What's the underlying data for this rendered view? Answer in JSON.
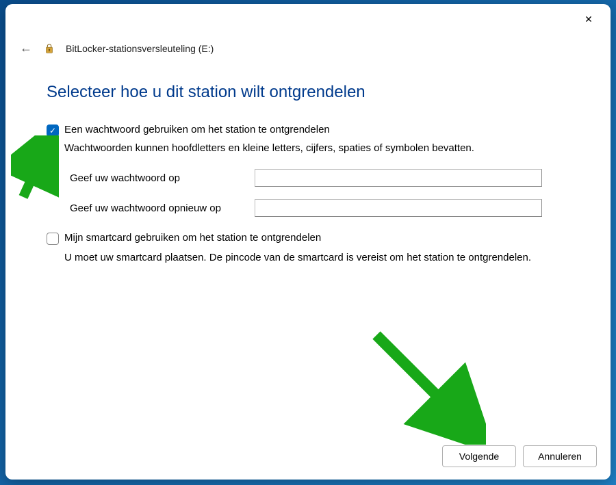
{
  "window": {
    "breadcrumb": "BitLocker-stationsversleuteling (E:)"
  },
  "page": {
    "title": "Selecteer hoe u dit station wilt ontgrendelen"
  },
  "options": {
    "password": {
      "checked": true,
      "label": "Een wachtwoord gebruiken om het station te ontgrendelen",
      "helper": "Wachtwoorden kunnen hoofdletters en kleine letters, cijfers, spaties of symbolen bevatten.",
      "field1_label": "Geef uw wachtwoord op",
      "field1_value": "",
      "field2_label": "Geef uw wachtwoord opnieuw op",
      "field2_value": ""
    },
    "smartcard": {
      "checked": false,
      "label": "Mijn smartcard gebruiken om het station te ontgrendelen",
      "helper": "U moet uw smartcard plaatsen. De pincode van de smartcard is vereist om het station te ontgrendelen."
    }
  },
  "footer": {
    "next": "Volgende",
    "cancel": "Annuleren"
  },
  "icons": {
    "close": "✕",
    "back": "←",
    "check": "✓"
  }
}
